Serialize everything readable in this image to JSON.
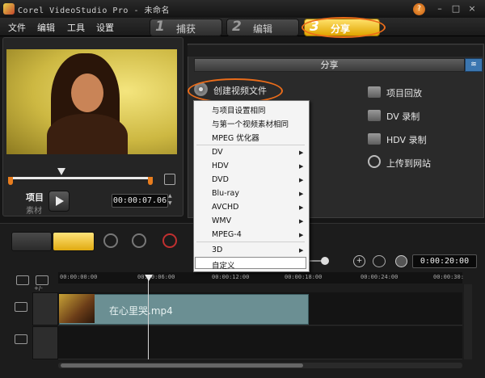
{
  "window": {
    "title": "Corel VideoStudio Pro - 未命名",
    "help_label": "?",
    "minimize": "–",
    "maximize": "□",
    "close": "×"
  },
  "menu": {
    "items": [
      "文件",
      "编辑",
      "工具",
      "设置"
    ]
  },
  "steps": [
    {
      "num": "1",
      "label": "捕获",
      "active": false
    },
    {
      "num": "2",
      "label": "编辑",
      "active": false
    },
    {
      "num": "3",
      "label": "分享",
      "active": true
    }
  ],
  "player": {
    "project_label": "项目",
    "clip_label": "素材",
    "timecode": "00:00:07.06"
  },
  "share_panel": {
    "header": "分享",
    "collapse_glyph": "≋",
    "options": {
      "create_video": "创建视频文件",
      "project_playback": "项目回放",
      "dv_record": "DV 录制",
      "hdv_record": "HDV 录制",
      "upload_web": "上传到网站"
    }
  },
  "dropdown": {
    "items": [
      {
        "label": "与项目设置相同",
        "submenu": false
      },
      {
        "label": "与第一个视频素材相同",
        "submenu": false
      },
      {
        "label": "MPEG 优化器",
        "submenu": false
      },
      {
        "label": "DV",
        "submenu": true
      },
      {
        "label": "HDV",
        "submenu": true
      },
      {
        "label": "DVD",
        "submenu": true
      },
      {
        "label": "Blu-ray",
        "submenu": true
      },
      {
        "label": "AVCHD",
        "submenu": true
      },
      {
        "label": "WMV",
        "submenu": true
      },
      {
        "label": "MPEG-4",
        "submenu": true
      },
      {
        "label": "3D",
        "submenu": true
      },
      {
        "label": "自定义",
        "submenu": false,
        "highlighted": true
      }
    ],
    "arrow_glyph": "▶"
  },
  "timeline": {
    "duration": "0:00:20:00",
    "ruler_labels": [
      "00:00:00:00",
      "00:00:06:00",
      "00:00:12:00",
      "00:00:18:00",
      "00:00:24:00",
      "00:00:30:"
    ],
    "clip_name": "在心里哭.mp4",
    "zoom_in_glyph": "+",
    "track_menu": "+/-"
  }
}
